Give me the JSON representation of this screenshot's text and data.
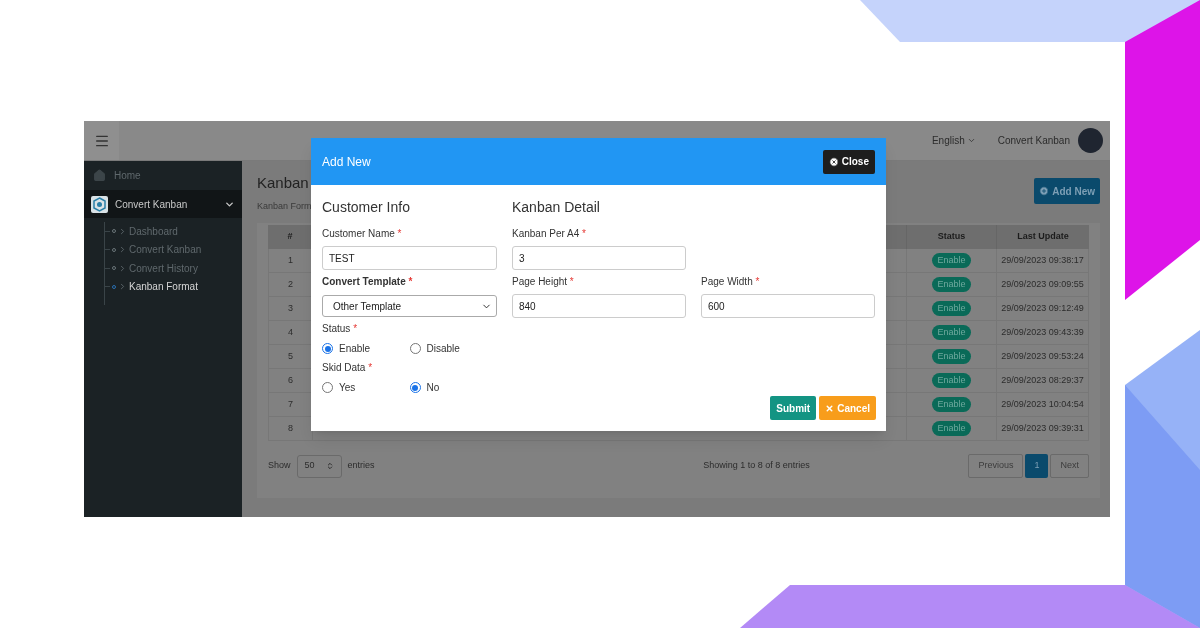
{
  "top_bar": {
    "language": "English",
    "user": "Convert Kanban"
  },
  "sidebar": {
    "items": [
      {
        "label": "Home",
        "kind": "link",
        "selected": false
      },
      {
        "label": "Convert Kanban",
        "kind": "group",
        "selected": true,
        "expanded": true,
        "children": [
          {
            "label": "Dashboard",
            "selected": false
          },
          {
            "label": "Convert Kanban",
            "selected": false
          },
          {
            "label": "Convert History",
            "selected": false
          },
          {
            "label": "Kanban Format",
            "selected": true
          }
        ]
      }
    ]
  },
  "page": {
    "title": "Kanban",
    "subtitle": "Kanban Form",
    "add_button": "Add New"
  },
  "table": {
    "columns": [
      "#",
      "Status",
      "Last Update"
    ],
    "rows": [
      {
        "number": "1",
        "status": "Enable",
        "last_update": "29/09/2023 09:38:17"
      },
      {
        "number": "2",
        "status": "Enable",
        "last_update": "29/09/2023 09:09:55"
      },
      {
        "number": "3",
        "status": "Enable",
        "last_update": "29/09/2023 09:12:49"
      },
      {
        "number": "4",
        "status": "Enable",
        "last_update": "29/09/2023 09:43:39"
      },
      {
        "number": "5",
        "status": "Enable",
        "last_update": "29/09/2023 09:53:24"
      },
      {
        "number": "6",
        "status": "Enable",
        "last_update": "29/09/2023 08:29:37"
      },
      {
        "number": "7",
        "status": "Enable",
        "last_update": "29/09/2023 10:04:54"
      },
      {
        "number": "8",
        "status": "Enable",
        "last_update": "29/09/2023 09:39:31"
      }
    ]
  },
  "footer": {
    "show_label": "Show",
    "page_size": "50",
    "entries_label": "entries",
    "info": "Showing 1 to 8 of 8 entries",
    "pagination": [
      {
        "label": "Previous",
        "selected": false
      },
      {
        "label": "1",
        "selected": true
      },
      {
        "label": "Next",
        "selected": false
      }
    ]
  },
  "modal": {
    "title": "Add New",
    "close": "Close",
    "customer_info": {
      "heading": "Customer Info",
      "fields": [
        {
          "kind": "text",
          "label": "Customer Name",
          "mark": "*",
          "emphasized": false,
          "value": "TEST"
        },
        {
          "kind": "select",
          "label": "Convert Template",
          "mark": "*",
          "emphasized": true,
          "value": "Other Template"
        },
        {
          "kind": "radio",
          "label": "Status",
          "mark": "*",
          "emphasized": false,
          "options": [
            {
              "label": "Enable",
              "selected": true
            },
            {
              "label": "Disable",
              "selected": false
            }
          ]
        },
        {
          "kind": "radio",
          "label": "Skid Data",
          "mark": "*",
          "emphasized": false,
          "options": [
            {
              "label": "Yes",
              "selected": false
            },
            {
              "label": "No",
              "selected": true
            }
          ]
        }
      ]
    },
    "kanban_detail": {
      "heading": "Kanban Detail",
      "rows": [
        [
          {
            "label": "Kanban Per A4",
            "mark": "*",
            "value": "3"
          }
        ],
        [
          {
            "label": "Page Height",
            "mark": "*",
            "value": "840"
          },
          {
            "label": "Page Width",
            "mark": "*",
            "value": "600"
          }
        ]
      ]
    },
    "buttons": [
      {
        "kind": "submit",
        "label": "Submit"
      },
      {
        "kind": "cancel",
        "label": "Cancel"
      }
    ]
  }
}
